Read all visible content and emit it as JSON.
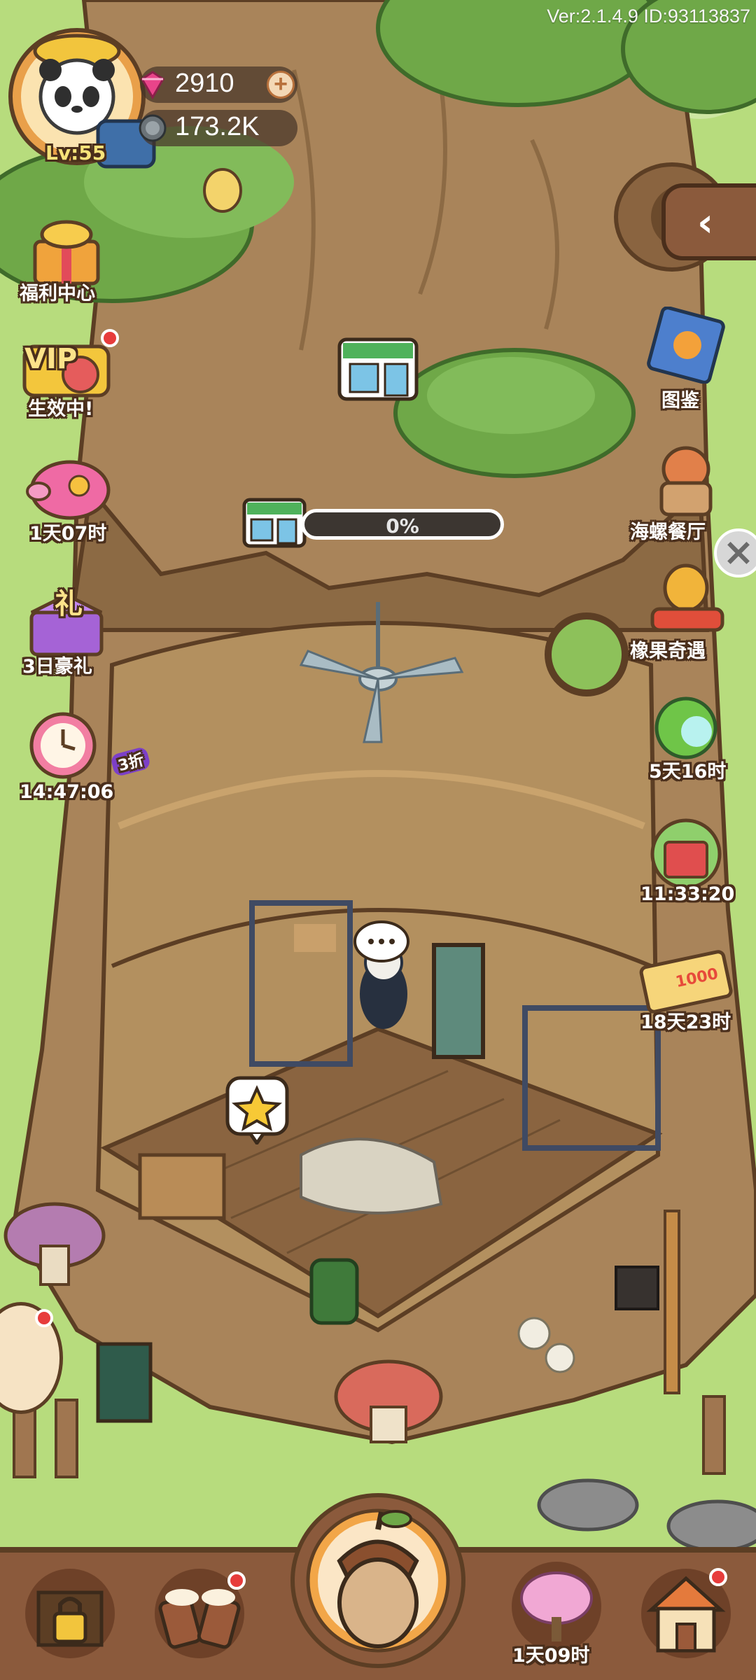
{
  "header": {
    "version_text": "Ver:2.1.4.9 ID:93113837",
    "player_level": "Lv:55",
    "gems": "2910",
    "acorns": "173.2K"
  },
  "left_menu": [
    {
      "label": "福利中心",
      "icon": "gift-box-icon",
      "badge": false
    },
    {
      "label": "生效中!",
      "icon": "vip-icon",
      "badge": true,
      "tag": "VIP"
    },
    {
      "label": "1天07时",
      "icon": "piggy-bank-icon",
      "badge": false
    },
    {
      "label": "3日豪礼",
      "icon": "gift-chest-icon",
      "badge": false,
      "tag": "礼"
    },
    {
      "label": "14:47:06",
      "icon": "alarm-clock-icon",
      "badge": false,
      "tag": "3折"
    }
  ],
  "right_menu": [
    {
      "label": "图鉴",
      "icon": "collection-book-icon"
    },
    {
      "label": "海螺餐厅",
      "icon": "octopus-restaurant-icon"
    },
    {
      "label": "橡果奇遇",
      "icon": "acorn-adventure-icon"
    },
    {
      "label": "5天16时",
      "icon": "green-potion-icon"
    },
    {
      "label": "11:33:20",
      "icon": "gift-house-icon"
    },
    {
      "label": "18天23时",
      "icon": "discount-ticket-icon",
      "tag": "1000"
    }
  ],
  "scene": {
    "shop_progress_text": "0%",
    "shop_progress": 0,
    "star_bubble": "star-icon"
  },
  "bottom_bar": [
    {
      "label": "",
      "icon": "locked-shop-icon",
      "badge": false
    },
    {
      "label": "",
      "icon": "cheers-mug-icon",
      "badge": true
    },
    {
      "label": "",
      "icon": "acorn-main-icon",
      "badge": false
    },
    {
      "label": "1天09时",
      "icon": "sakura-tree-icon",
      "badge": false
    },
    {
      "label": "",
      "icon": "house-icon",
      "badge": true
    }
  ],
  "colors": {
    "grass": "#b7dc7d",
    "trunk": "#a9845a",
    "trunk_dark": "#7b5a38",
    "leaves": "#6fa848",
    "floor": "#8a6440",
    "bottom_bar": "#8b5a3c"
  }
}
